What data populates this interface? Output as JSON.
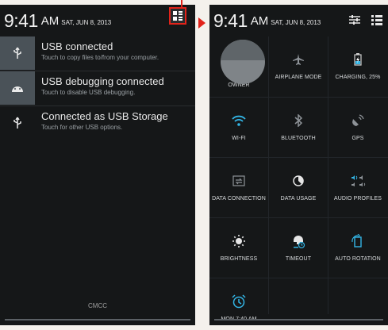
{
  "status": {
    "time": "9:41",
    "ampm": "AM",
    "date": "SAT, JUN 8, 2013"
  },
  "notifications": [
    {
      "title": "USB connected",
      "subtitle": "Touch to copy files to/from your computer.",
      "icon": "usb-icon"
    },
    {
      "title": "USB debugging connected",
      "subtitle": "Touch to disable USB debugging.",
      "icon": "android-icon"
    },
    {
      "title": "Connected as USB Storage",
      "subtitle": "Touch for other USB options.",
      "icon": "usb-icon"
    }
  ],
  "carrier": "CMCC",
  "quick_settings": {
    "owner": "OWNER",
    "airplane": "AIRPLANE MODE",
    "charging": "CHARGING, 25%",
    "wifi": "WI-FI",
    "bluetooth": "BLUETOOTH",
    "gps": "GPS",
    "data_connection": "DATA CONNECTION",
    "data_usage": "DATA USAGE",
    "audio_profiles": "AUDIO PROFILES",
    "brightness": "BRIGHTNESS",
    "timeout": "TIMEOUT",
    "auto_rotation": "AUTO ROTATION",
    "alarm": "MON 7:40 AM"
  },
  "colors": {
    "accent": "#33b5e5",
    "highlight": "#e2231a",
    "panel": "#151718"
  }
}
